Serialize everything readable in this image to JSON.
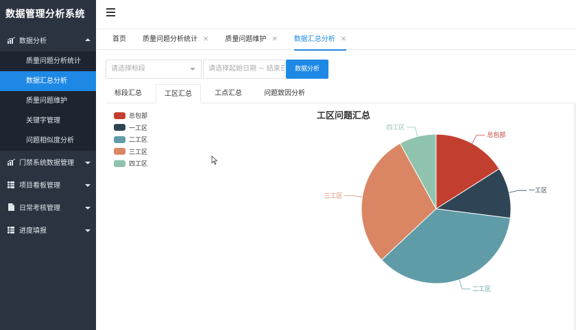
{
  "app": {
    "title": "数据管理分析系统"
  },
  "sidebar": {
    "groups": [
      {
        "label": "数据分析",
        "icon": "bar-chart-icon",
        "expanded": true,
        "items": [
          {
            "label": "质量问题分析统计"
          },
          {
            "label": "数据汇总分析",
            "active": true
          },
          {
            "label": "质量问题维护"
          },
          {
            "label": "关键字管理"
          },
          {
            "label": "问题相似度分析"
          }
        ]
      },
      {
        "label": "门禁系统数据管理",
        "icon": "bar-chart-icon"
      },
      {
        "label": "项目看板管理",
        "icon": "table-icon"
      },
      {
        "label": "日常考核管理",
        "icon": "document-icon"
      },
      {
        "label": "进度填报",
        "icon": "table-icon"
      }
    ]
  },
  "tabs": [
    {
      "label": "首页",
      "closable": false
    },
    {
      "label": "质量问题分析统计",
      "closable": true
    },
    {
      "label": "质量问题维护",
      "closable": true
    },
    {
      "label": "数据汇总分析",
      "closable": true,
      "active": true
    }
  ],
  "filters": {
    "section_placeholder": "请选择标段",
    "date_placeholder": "请选择起始日期 ~ 结束日期",
    "analyze_button": "数据分析"
  },
  "subtabs": [
    {
      "label": "标段汇总"
    },
    {
      "label": "工区汇总",
      "active": true
    },
    {
      "label": "工点汇总"
    },
    {
      "label": "问题致因分析"
    }
  ],
  "colors": {
    "accent": "#1e88e5",
    "sidebar": "#2b3340"
  },
  "chart_data": {
    "type": "pie",
    "title": "工区问题汇总",
    "legend_position": "top-left",
    "slices": [
      {
        "name": "总包部",
        "value": 16,
        "color": "#c23f2f"
      },
      {
        "name": "一工区",
        "value": 11,
        "color": "#2f4555"
      },
      {
        "name": "二工区",
        "value": 36,
        "color": "#5f9ca8"
      },
      {
        "name": "三工区",
        "value": 29,
        "color": "#da8664"
      },
      {
        "name": "四工区",
        "value": 8,
        "color": "#8fc3ad"
      }
    ]
  }
}
